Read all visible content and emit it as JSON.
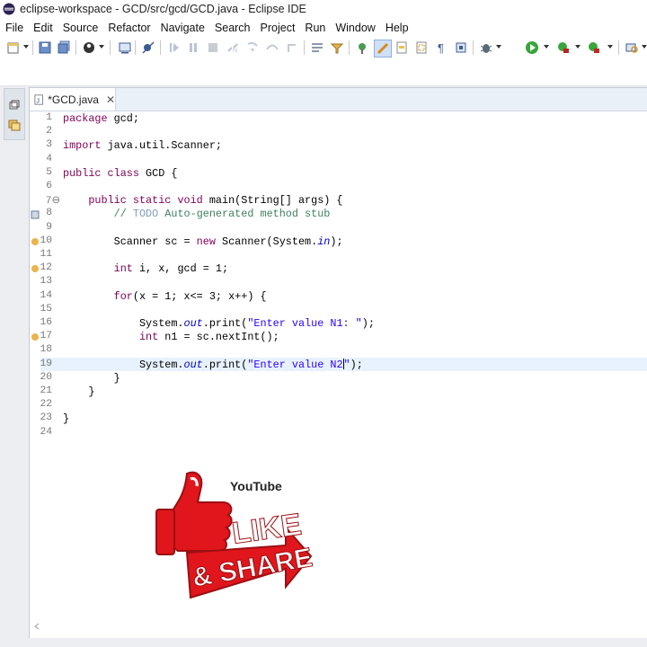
{
  "window": {
    "title": "eclipse-workspace - GCD/src/gcd/GCD.java - Eclipse IDE"
  },
  "menu": [
    "File",
    "Edit",
    "Source",
    "Refactor",
    "Navigate",
    "Search",
    "Project",
    "Run",
    "Window",
    "Help"
  ],
  "toolbar": {
    "icons": [
      "new-icon",
      "save-icon",
      "save-all-icon",
      "profile-icon",
      "console-icon",
      "skip-breakpoints-icon",
      "resume-icon",
      "suspend-icon",
      "terminate-icon",
      "disconnect-icon",
      "step-into-icon",
      "step-over-icon",
      "step-return-icon",
      "drop-to-frame-icon",
      "use-step-filters-icon",
      "open-type-icon",
      "task-icon",
      "mark-occurrences-icon",
      "toggle-block-selection-icon",
      "show-whitespace-icon",
      "open-perspective-icon",
      "debug-icon",
      "run-icon",
      "coverage-icon",
      "external-tools-icon",
      "search-icon"
    ]
  },
  "editor": {
    "tab_title": "*GCD.java",
    "tab_close": "✕",
    "lines": [
      {
        "n": "1",
        "t": "package gcd;"
      },
      {
        "n": "2",
        "t": ""
      },
      {
        "n": "3",
        "t": "import java.util.Scanner;"
      },
      {
        "n": "4",
        "t": ""
      },
      {
        "n": "5",
        "t": "public class GCD {"
      },
      {
        "n": "6",
        "t": ""
      },
      {
        "n": "7⊖",
        "t": "    public static void main(String[] args) {"
      },
      {
        "n": "8",
        "t": "        // TODO Auto-generated method stub"
      },
      {
        "n": "9",
        "t": ""
      },
      {
        "n": "10",
        "t": "        Scanner sc = new Scanner(System.in);"
      },
      {
        "n": "11",
        "t": ""
      },
      {
        "n": "12",
        "t": "        int i, x, gcd = 1;"
      },
      {
        "n": "13",
        "t": ""
      },
      {
        "n": "14",
        "t": "        for(x = 1; x<= 3; x++) {"
      },
      {
        "n": "15",
        "t": ""
      },
      {
        "n": "16",
        "t": "            System.out.print(\"Enter value N1: \");"
      },
      {
        "n": "17",
        "t": "            int n1 = sc.nextInt();"
      },
      {
        "n": "18",
        "t": ""
      },
      {
        "n": "19",
        "t": "            System.out.print(\"Enter value N2\");"
      },
      {
        "n": "20",
        "t": "        }"
      },
      {
        "n": "21",
        "t": "    }"
      },
      {
        "n": "22",
        "t": ""
      },
      {
        "n": "23",
        "t": "}"
      },
      {
        "n": "24",
        "t": ""
      }
    ]
  },
  "overlay": {
    "youtube_label": "YouTube",
    "like_label": "LIKE",
    "share_label": "& SHARE"
  },
  "colors": {
    "keyword": "#7f0055",
    "comment": "#3f7f5f",
    "string": "#2a00ff",
    "field": "#0000c0",
    "ruler": "#7b9cc9",
    "brand_red": "#e0161c"
  }
}
